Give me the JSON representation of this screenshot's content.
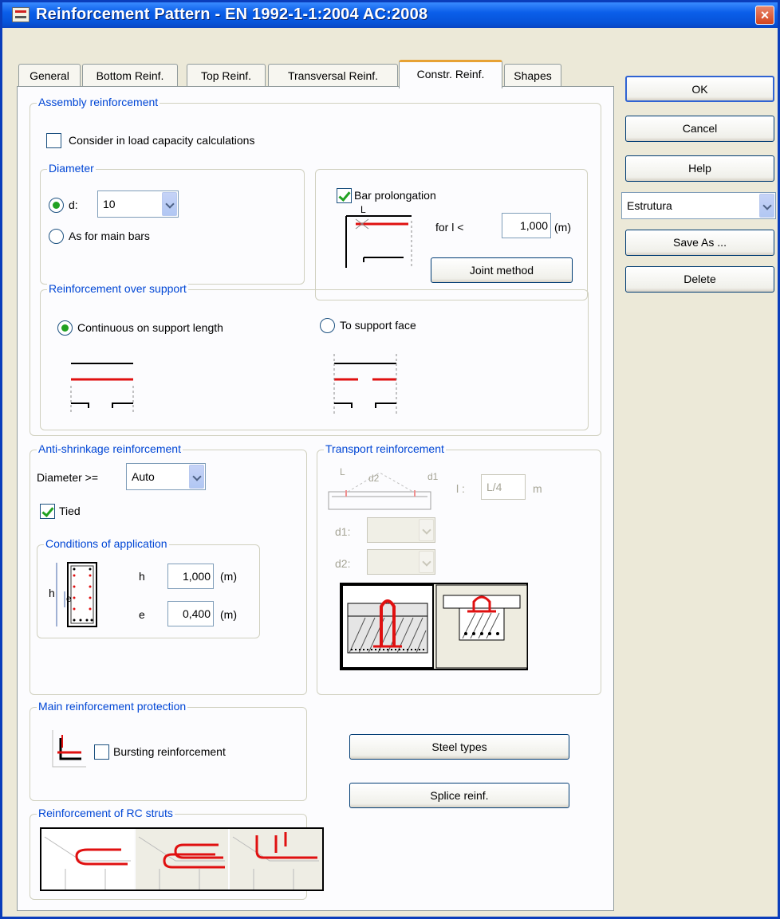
{
  "window": {
    "title": "Reinforcement Pattern - EN 1992-1-1:2004 AC:2008",
    "close_label": "×"
  },
  "tabs": [
    "General",
    "Bottom Reinf.",
    "Top Reinf.",
    "Transversal Reinf.",
    "Constr. Reinf.",
    "Shapes"
  ],
  "active_tab": "Constr. Reinf.",
  "assembly": {
    "legend": "Assembly reinforcement",
    "consider_label": "Consider in load capacity calculations",
    "consider_checked": false,
    "diameter": {
      "legend": "Diameter",
      "d_label": "d:",
      "d_value": "10",
      "as_main_label": "As for main bars",
      "selected": "d"
    },
    "bar_prolongation": {
      "label": "Bar prolongation",
      "checked": true,
      "diagram_l": "L",
      "for_label": "for l <",
      "value": "1,000",
      "unit": "(m)",
      "joint_button": "Joint method"
    },
    "over_support": {
      "legend": "Reinforcement over support",
      "continuous_label": "Continuous on support length",
      "face_label": "To support face",
      "selected": "continuous"
    }
  },
  "anti_shrinkage": {
    "legend": "Anti-shrinkage reinforcement",
    "diameter_label": "Diameter >=",
    "diameter_value": "Auto",
    "tied_label": "Tied",
    "tied_checked": true,
    "conditions": {
      "legend": "Conditions of application",
      "h_label": "h",
      "h_value": "1,000",
      "h_unit": "(m)",
      "e_label": "e",
      "e_value": "0,400",
      "e_unit": "(m)",
      "diagram_h": "h",
      "diagram_e": "e"
    }
  },
  "transport": {
    "legend": "Transport reinforcement",
    "diagram_l": "L",
    "diagram_d2": "d2",
    "diagram_d1": "d1",
    "l_label": "l :",
    "l_value": "L/4",
    "l_unit": "m",
    "d1_label": "d1:",
    "d2_label": "d2:"
  },
  "protection": {
    "legend": "Main reinforcement protection",
    "bursting_label": "Bursting reinforcement",
    "bursting_checked": false
  },
  "struts": {
    "legend": "Reinforcement of RC struts"
  },
  "buttons": {
    "steel_types": "Steel types",
    "splice": "Splice reinf.",
    "ok": "OK",
    "cancel": "Cancel",
    "help": "Help",
    "save_as": "Save As ...",
    "delete": "Delete"
  },
  "preset": {
    "value": "Estrutura"
  },
  "colors": {
    "title_bar": "#0a5ee9",
    "accent_red": "#e01010",
    "group_label": "#0046d5",
    "check_green": "#21a121"
  }
}
